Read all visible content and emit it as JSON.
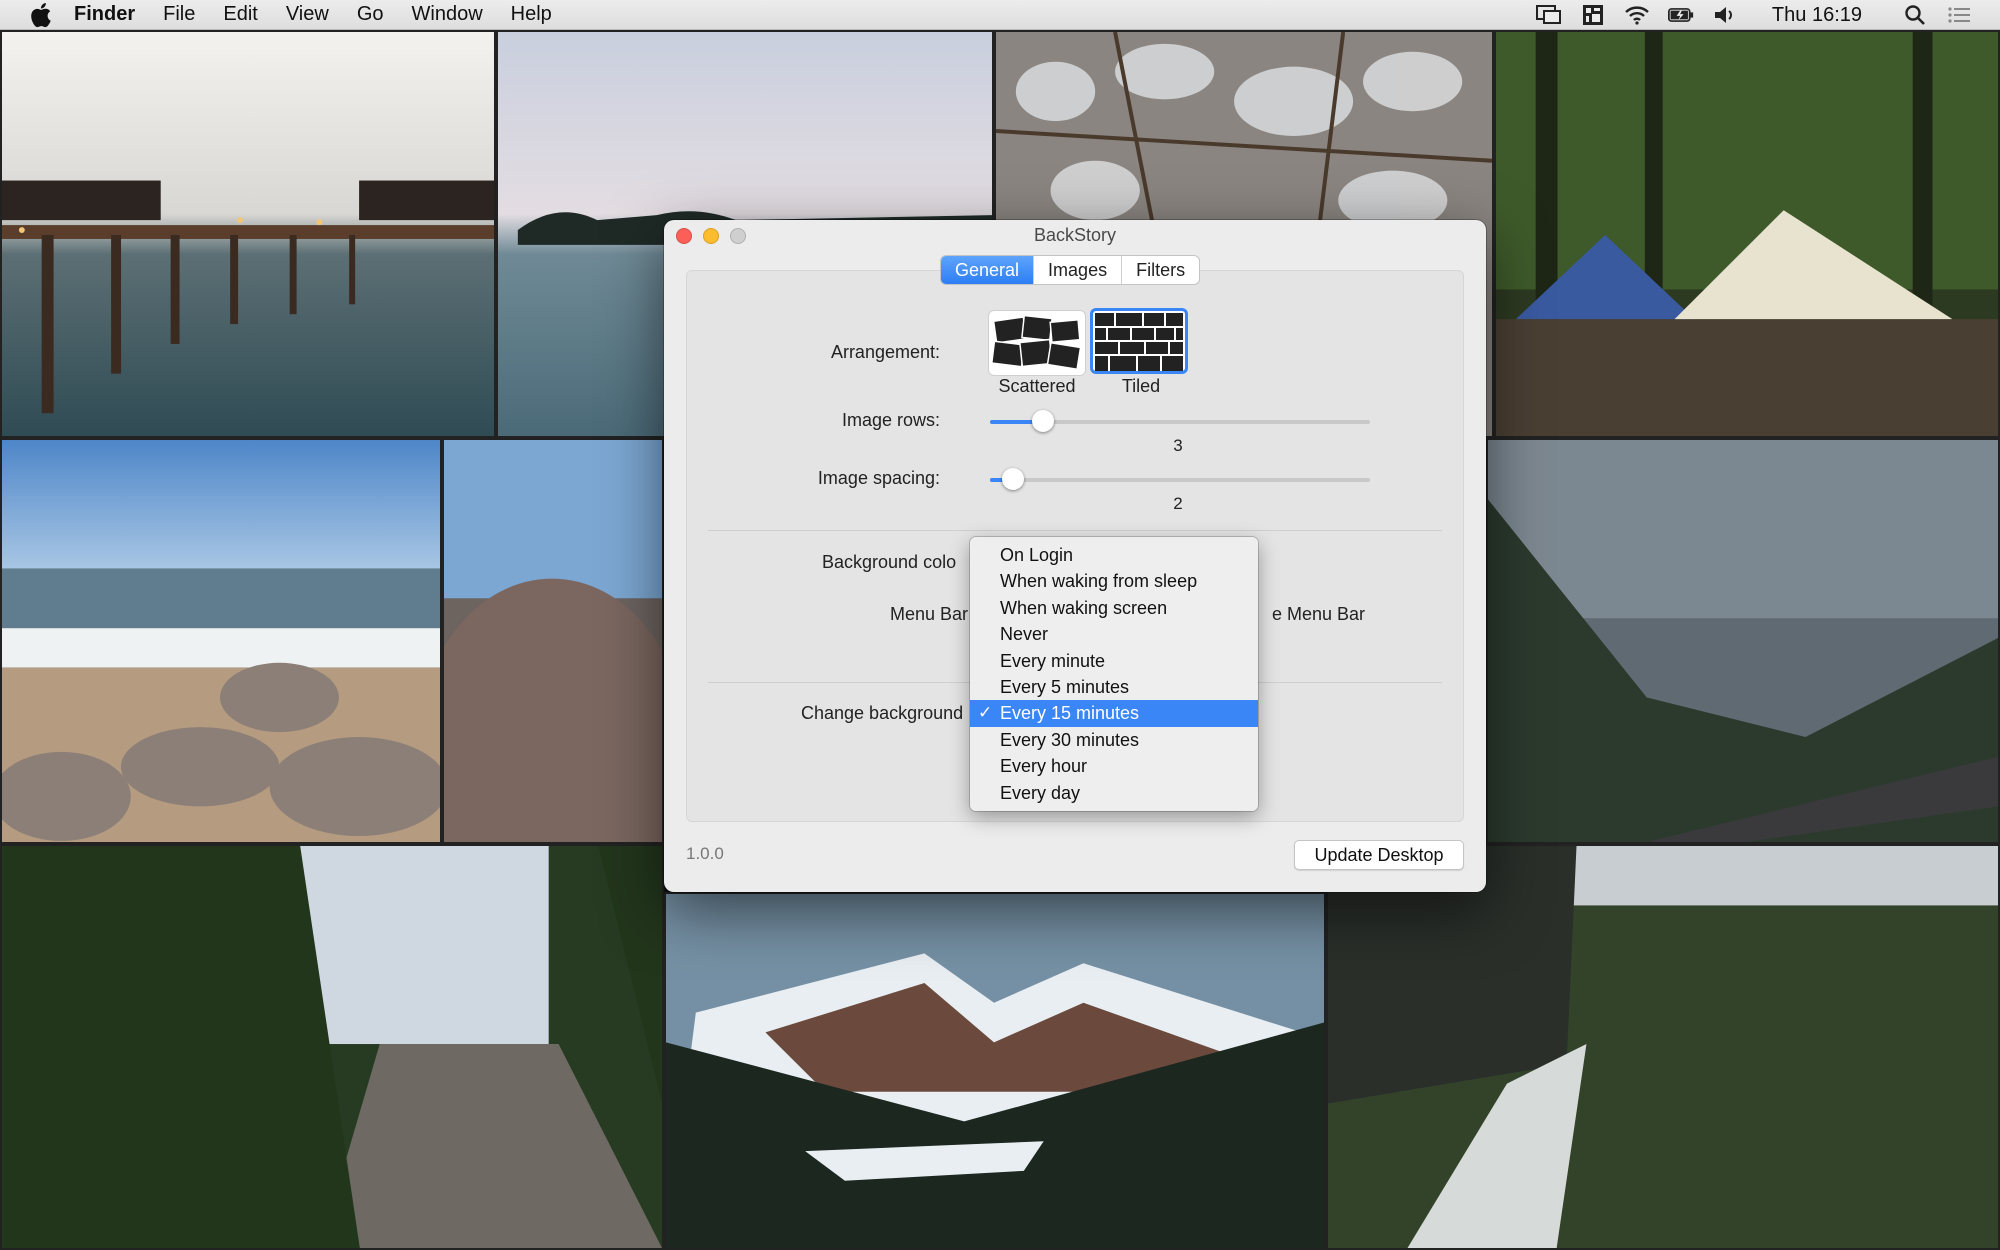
{
  "menubar": {
    "app": "Finder",
    "items": [
      "File",
      "Edit",
      "View",
      "Go",
      "Window",
      "Help"
    ],
    "clock": "Thu 16:19",
    "icons": [
      "display-icon",
      "grid-icon",
      "wifi-icon",
      "battery-icon",
      "volume-icon",
      "search-icon",
      "list-icon"
    ]
  },
  "window": {
    "title": "BackStory",
    "tabs": [
      "General",
      "Images",
      "Filters"
    ],
    "active_tab": "General",
    "arrangement": {
      "label": "Arrangement:",
      "options": [
        "Scattered",
        "Tiled"
      ],
      "selected": "Tiled"
    },
    "image_rows": {
      "label": "Image rows:",
      "value": "3",
      "fraction": 0.14
    },
    "image_spacing": {
      "label": "Image spacing:",
      "value": "2",
      "fraction": 0.06
    },
    "background_color": {
      "label": "Background colo"
    },
    "menu_bar": {
      "label": "Menu Bar",
      "trailing": "e Menu Bar"
    },
    "change_background": {
      "label": "Change background",
      "options": [
        "On Login",
        "When waking from sleep",
        "When waking screen",
        "Never",
        "Every minute",
        "Every 5 minutes",
        "Every 15 minutes",
        "Every 30 minutes",
        "Every hour",
        "Every day"
      ],
      "selected": "Every 15 minutes"
    },
    "version": "1.0.0",
    "update_button": "Update Desktop"
  },
  "colors": {
    "accent": "#3b86f7",
    "close": "#fc5f57",
    "minimize": "#fdbc2e"
  }
}
